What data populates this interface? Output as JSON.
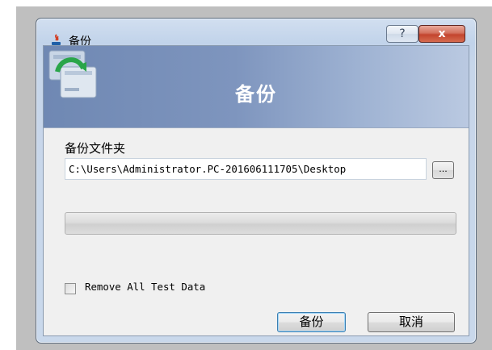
{
  "window": {
    "title": "备份",
    "help_label": "?",
    "close_label": "x"
  },
  "banner": {
    "title": "备份"
  },
  "form": {
    "folder_label": "备份文件夹",
    "path_value": "C:\\Users\\Administrator.PC-201606111705\\Desktop",
    "browse_label": "...",
    "progress_fraction": 0,
    "checkbox_label": "Remove All Test Data",
    "checkbox_checked": false
  },
  "buttons": {
    "backup_label": "备份",
    "cancel_label": "取消"
  },
  "colors": {
    "banner_left": "#6f88b3",
    "banner_right": "#bac9e1",
    "progress_fill": "#06b025",
    "close_button": "#c3452e"
  }
}
